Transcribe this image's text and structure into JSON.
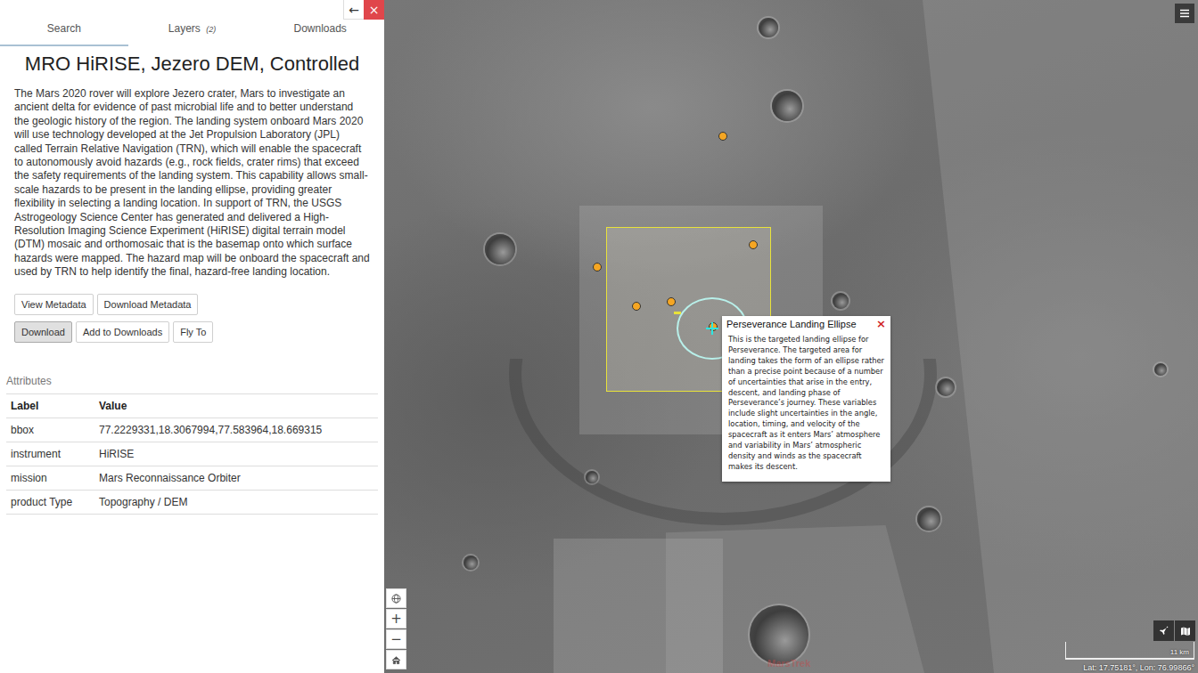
{
  "panel": {
    "nav": {
      "back": "←",
      "close": "×"
    },
    "tabs": [
      {
        "label": "Search",
        "count": "",
        "selected": true
      },
      {
        "label": "Layers",
        "count": "(2)",
        "selected": false
      },
      {
        "label": "Downloads",
        "count": "",
        "selected": false
      }
    ],
    "title": "MRO HiRISE, Jezero DEM, Controlled",
    "description": "The Mars 2020 rover will explore Jezero crater, Mars to investigate an ancient delta for evidence of past microbial life and to better understand the geologic history of the region. The landing system onboard Mars 2020 will use technology developed at the Jet Propulsion Laboratory (JPL) called Terrain Relative Navigation (TRN), which will enable the spacecraft to autonomously avoid hazards (e.g., rock fields, crater rims) that exceed the safety requirements of the landing system. This capability allows small-scale hazards to be present in the landing ellipse, providing greater flexibility in selecting a landing location. In support of TRN, the USGS Astrogeology Science Center has generated and delivered a High-Resolution Imaging Science Experiment (HiRISE) digital terrain model (DTM) mosaic and orthomosaic that is the basemap onto which surface hazards were mapped. The hazard map will be onboard the spacecraft and used by TRN to help identify the final, hazard-free landing location.",
    "button_rows": [
      [
        {
          "label": "View Metadata",
          "pressed": false
        },
        {
          "label": "Download Metadata",
          "pressed": false
        }
      ],
      [
        {
          "label": "Download",
          "pressed": true
        },
        {
          "label": "Add to Downloads",
          "pressed": false
        },
        {
          "label": "Fly To",
          "pressed": false
        }
      ]
    ],
    "attributes": {
      "heading": "Attributes",
      "columns": [
        "Label",
        "Value"
      ],
      "rows": [
        [
          "bbox",
          "77.2229331,18.3067994,77.583964,18.669315"
        ],
        [
          "instrument",
          "HiRISE"
        ],
        [
          "mission",
          "Mars Reconnaissance Orbiter"
        ],
        [
          "product Type",
          "Topography / DEM"
        ]
      ]
    }
  },
  "map": {
    "popup": {
      "title": "Perseverance Landing Ellipse",
      "close": "×",
      "body": "This is the targeted landing ellipse for Perseverance. The targeted area for landing takes the form of an ellipse rather than a precise point because of a number of uncertainties that arise in the entry, descent, and landing phase of Perseverance’s journey. These variables include slight uncertainties in the angle, location, timing, and velocity of the spacecraft as it enters Mars’ atmosphere and variability in Mars’ atmospheric density and winds as the spacecraft makes its descent."
    },
    "zoom_in": "+",
    "zoom_out": "−",
    "scale": "11 km",
    "coordinates": "Lat: 17.75181°, Lon: 76.99866°",
    "logo": "MarsTrek"
  }
}
